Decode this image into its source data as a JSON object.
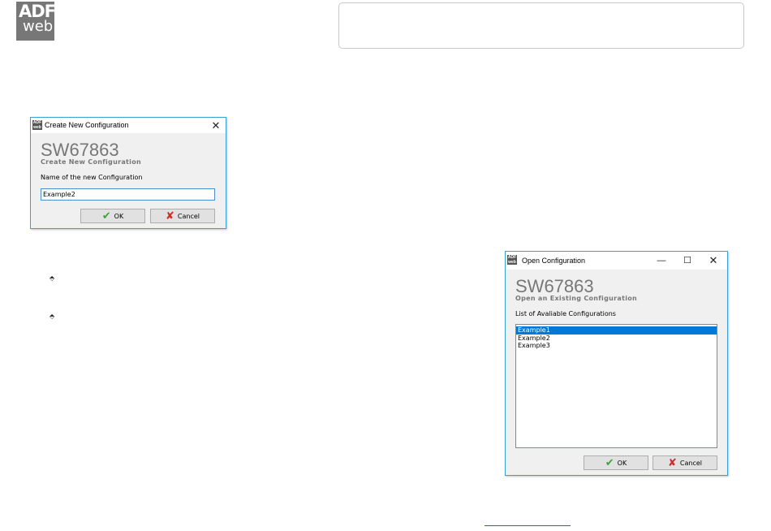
{
  "logo": {
    "line1": "ADF",
    "line2": "web"
  },
  "create_dialog": {
    "window_title": "Create New Configuration",
    "app_title": "SW67863",
    "subtitle": "Create New Configuration",
    "field_label": "Name of the new Configuration",
    "field_value": "Example2",
    "ok_label": "OK",
    "cancel_label": "Cancel"
  },
  "open_dialog": {
    "window_title": "Open Configuration",
    "app_title": "SW67863",
    "subtitle": "Open an Existing Configuration",
    "list_label": "List of Avaliable Configurations",
    "items": [
      "Example1",
      "Example2",
      "Example3"
    ],
    "selected_item": "Example1",
    "ok_label": "OK",
    "cancel_label": "Cancel"
  },
  "icons": {
    "app": "adfweb-app-icon",
    "ok": "checkmark-icon",
    "cancel": "x-icon",
    "bullet": "bullet-icon"
  }
}
